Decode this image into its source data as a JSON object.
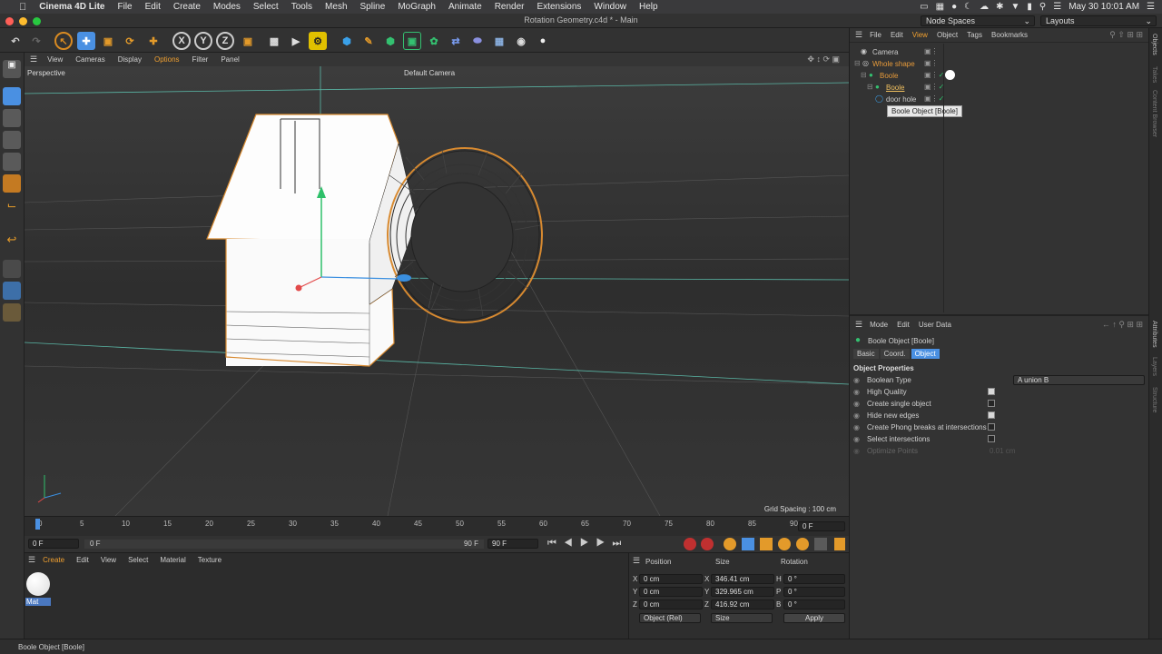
{
  "menubar": {
    "app": "Cinema 4D Lite",
    "items": [
      "File",
      "Edit",
      "Create",
      "Modes",
      "Select",
      "Tools",
      "Mesh",
      "Spline",
      "MoGraph",
      "Animate",
      "Render",
      "Extensions",
      "Window",
      "Help"
    ],
    "clock": "May 30  10:01 AM"
  },
  "window": {
    "title": "Rotation Geometry.c4d * - Main",
    "node_spaces": "Node Spaces",
    "layouts": "Layouts"
  },
  "viewport": {
    "menu": [
      "View",
      "Cameras",
      "Display",
      "Options",
      "Filter",
      "Panel"
    ],
    "label": "Perspective",
    "camera": "Default Camera",
    "grid_spacing": "Grid Spacing : 100 cm"
  },
  "timeline": {
    "ticks": [
      "0",
      "5",
      "10",
      "15",
      "20",
      "25",
      "30",
      "35",
      "40",
      "45",
      "50",
      "55",
      "60",
      "65",
      "70",
      "75",
      "80",
      "85",
      "90"
    ],
    "current_frame": "0 F",
    "start": "0 F",
    "range_start": "0 F",
    "range_end": "90 F",
    "end": "90 F"
  },
  "materials": {
    "menu": [
      "Create",
      "Edit",
      "View",
      "Select",
      "Material",
      "Texture"
    ],
    "items": [
      {
        "name": "Mat"
      }
    ]
  },
  "coords": {
    "headers": [
      "Position",
      "Size",
      "Rotation"
    ],
    "rows": [
      {
        "axis": "X",
        "pos": "0 cm",
        "saxis": "X",
        "size": "346.41 cm",
        "raxis": "H",
        "rot": "0 °"
      },
      {
        "axis": "Y",
        "pos": "0 cm",
        "saxis": "Y",
        "size": "329.965 cm",
        "raxis": "P",
        "rot": "0 °"
      },
      {
        "axis": "Z",
        "pos": "0 cm",
        "saxis": "Z",
        "size": "416.92 cm",
        "raxis": "B",
        "rot": "0 °"
      }
    ],
    "mode": "Object (Rel)",
    "size_mode": "Size",
    "apply": "Apply"
  },
  "objects": {
    "menu": [
      "File",
      "Edit",
      "View",
      "Object",
      "Tags",
      "Bookmarks"
    ],
    "items": [
      {
        "name": "Camera",
        "indent": 0
      },
      {
        "name": "Whole shape",
        "indent": 0
      },
      {
        "name": "Boole",
        "indent": 1
      },
      {
        "name": "Boole",
        "indent": 2
      },
      {
        "name": "door hole",
        "indent": 2
      }
    ],
    "tooltip": "Boole Object [Boole]"
  },
  "attributes": {
    "menu": [
      "Mode",
      "Edit",
      "User Data"
    ],
    "object_title": "Boole Object [Boole]",
    "tabs": [
      "Basic",
      "Coord.",
      "Object"
    ],
    "section": "Object Properties",
    "props": [
      {
        "label": "Boolean Type",
        "value": "A union B",
        "type": "select"
      },
      {
        "label": "High Quality",
        "type": "check",
        "checked": true
      },
      {
        "label": "Create single object",
        "type": "check",
        "checked": false
      },
      {
        "label": "Hide new edges",
        "type": "check",
        "checked": true
      },
      {
        "label": "Create Phong breaks at intersections",
        "type": "check",
        "checked": false
      },
      {
        "label": "Select intersections",
        "type": "check",
        "checked": false
      },
      {
        "label": "Optimize Points",
        "value": "0.01 cm",
        "type": "disabled"
      }
    ]
  },
  "sidetabs": [
    "Objects",
    "Takes",
    "Content Browser",
    "Attributes",
    "Layers",
    "Structure"
  ],
  "status": "Boole Object [Boole]",
  "colors": {
    "accent": "#4a8fd8",
    "selection": "#f0a030",
    "active_tab": "#4a90e2"
  }
}
